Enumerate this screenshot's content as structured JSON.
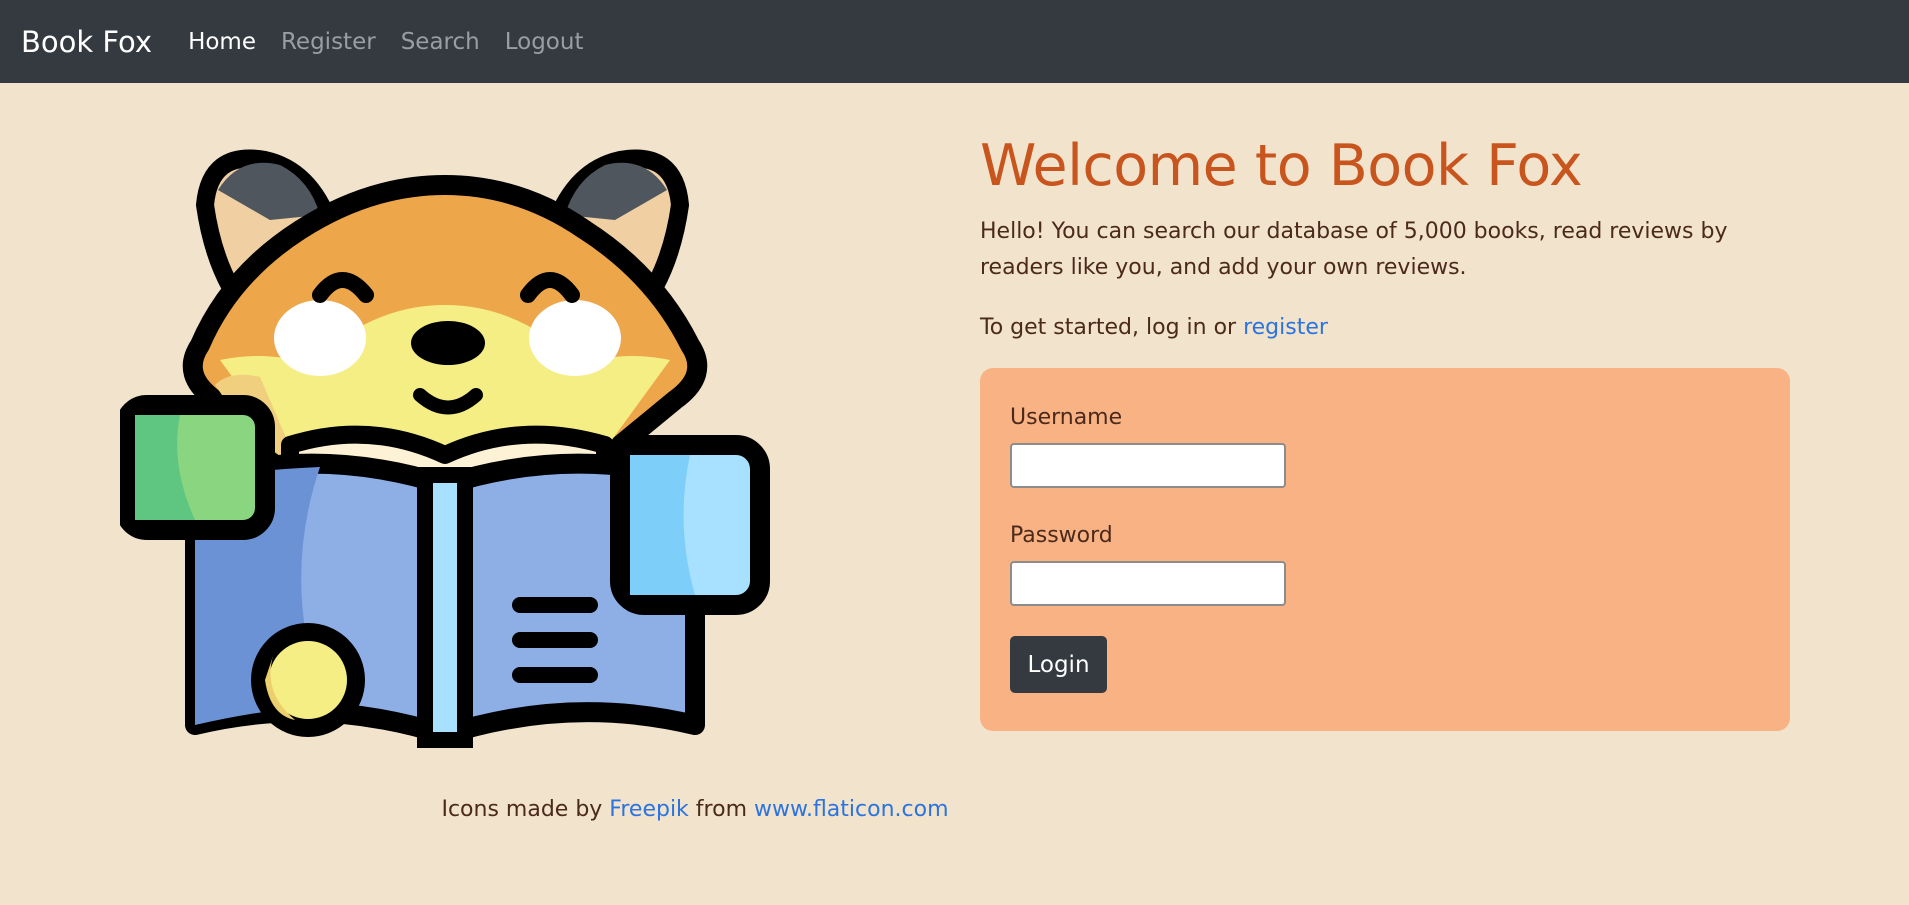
{
  "nav": {
    "brand": "Book Fox",
    "links": [
      "Home",
      "Register",
      "Search",
      "Logout"
    ]
  },
  "hero": {
    "title": "Welcome to Book Fox",
    "intro": "Hello! You can search our database of 5,000 books, read reviews by readers like you, and add your own reviews.",
    "started_prefix": "To get started, log in or ",
    "register_link": "register"
  },
  "login": {
    "username_label": "Username",
    "username_value": "",
    "password_label": "Password",
    "password_value": "",
    "button_label": "Login"
  },
  "footer": {
    "prefix": "Icons made by ",
    "author": "Freepik",
    "middle": " from ",
    "site": "www.flaticon.com"
  },
  "illustration": {
    "icon": "fox-reading-book-icon"
  },
  "colors": {
    "page_bg": "#f1e3cc",
    "navbar_bg": "#343a40",
    "title": "#c9551e",
    "card_bg": "#f8b284",
    "link": "#2b74e0",
    "text": "#4b2a1c"
  }
}
